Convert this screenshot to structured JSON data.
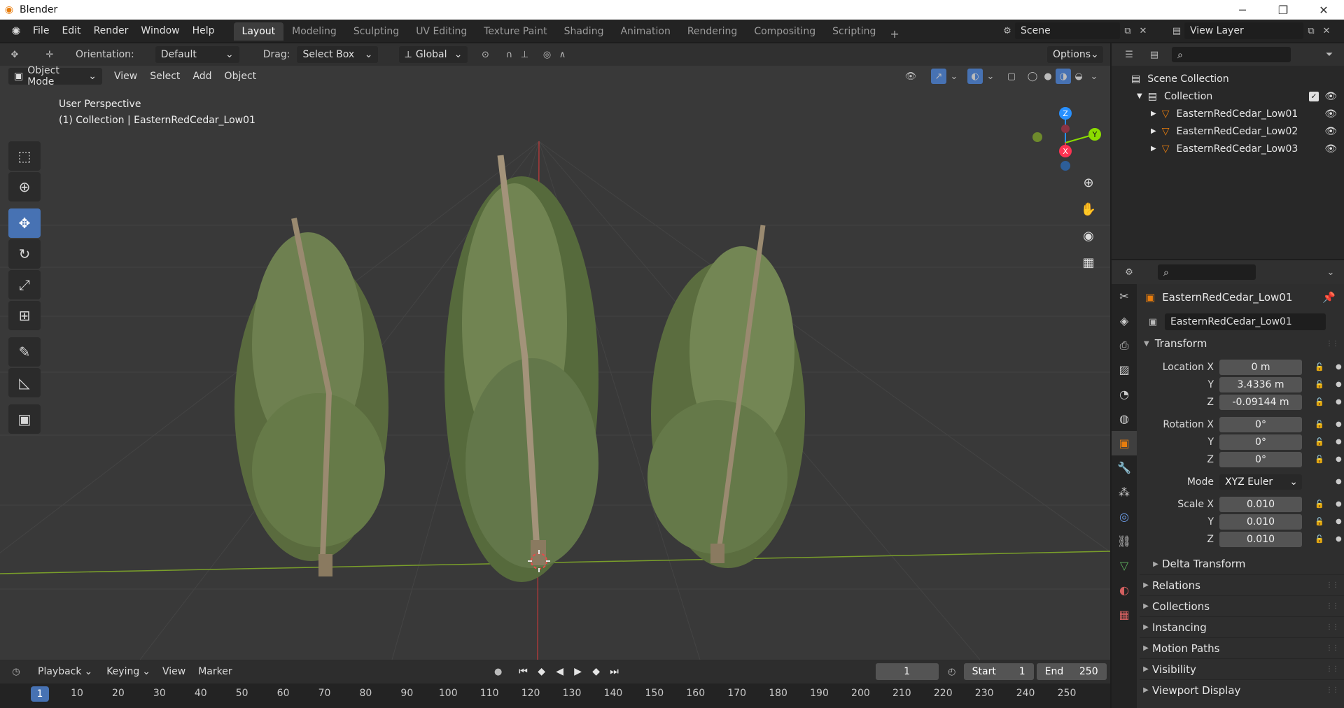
{
  "window": {
    "title": "Blender",
    "controls": [
      "─",
      "❐",
      "✕"
    ]
  },
  "topbar": {
    "menus": [
      "File",
      "Edit",
      "Render",
      "Window",
      "Help"
    ],
    "workspaces": [
      "Layout",
      "Modeling",
      "Sculpting",
      "UV Editing",
      "Texture Paint",
      "Shading",
      "Animation",
      "Rendering",
      "Compositing",
      "Scripting"
    ],
    "active_workspace": "Layout",
    "add_label": "+",
    "scene_name": "Scene",
    "view_layer": "View Layer"
  },
  "viewport_header": {
    "orientation_label": "Orientation:",
    "orientation_value": "Default",
    "drag_label": "Drag:",
    "drag_value": "Select Box",
    "transform_space": "Global",
    "options_label": "Options",
    "mode": "Object Mode",
    "menus": [
      "View",
      "Select",
      "Add",
      "Object"
    ]
  },
  "viewport": {
    "overlay_line1": "User Perspective",
    "overlay_line2": "(1) Collection | EasternRedCedar_Low01",
    "gizmo_axes": {
      "z": "Z",
      "y": "Y",
      "x": "X"
    },
    "colors": {
      "x_axis": "#ff3352",
      "y_axis": "#8bdc00",
      "z_axis": "#2890ff",
      "background": "#393939",
      "grid": "#444444"
    }
  },
  "tools": [
    "select-box",
    "cursor",
    "move",
    "rotate",
    "scale",
    "transform",
    "annotate",
    "measure",
    "add-cube"
  ],
  "timeline": {
    "menus": [
      "Playback",
      "Keying",
      "View",
      "Marker"
    ],
    "current_frame": "1",
    "start_label": "Start",
    "start_value": "1",
    "end_label": "End",
    "end_value": "250",
    "ruler": [
      "1",
      "10",
      "20",
      "30",
      "40",
      "50",
      "60",
      "70",
      "80",
      "90",
      "100",
      "110",
      "120",
      "130",
      "140",
      "150",
      "160",
      "170",
      "180",
      "190",
      "200",
      "210",
      "220",
      "230",
      "240",
      "250"
    ]
  },
  "outliner": {
    "scene_collection": "Scene Collection",
    "collection": "Collection",
    "objects": [
      "EasternRedCedar_Low01",
      "EasternRedCedar_Low02",
      "EasternRedCedar_Low03"
    ]
  },
  "properties": {
    "object_name": "EasternRedCedar_Low01",
    "object_field": "EasternRedCedar_Low01",
    "transform_title": "Transform",
    "location_label": "Location X",
    "location": [
      "0 m",
      "3.4336 m",
      "-0.09144 m"
    ],
    "rotation_label": "Rotation X",
    "rotation": [
      "0°",
      "0°",
      "0°"
    ],
    "mode_label": "Mode",
    "mode_value": "XYZ Euler",
    "scale_label": "Scale X",
    "scale": [
      "0.010",
      "0.010",
      "0.010"
    ],
    "axis_y": "Y",
    "axis_z": "Z",
    "delta_transform": "Delta Transform",
    "panels": [
      "Relations",
      "Collections",
      "Instancing",
      "Motion Paths",
      "Visibility",
      "Viewport Display"
    ]
  }
}
